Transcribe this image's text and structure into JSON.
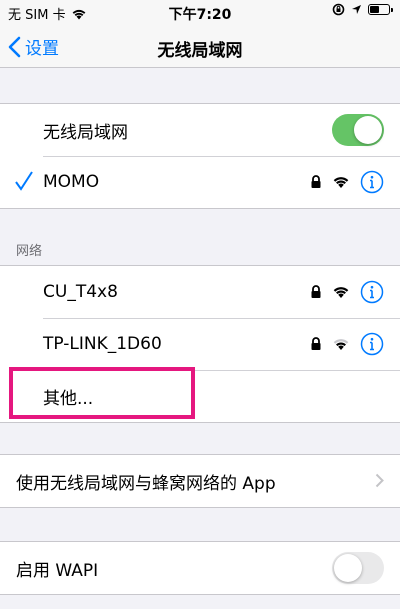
{
  "status_bar": {
    "carrier": "无 SIM 卡",
    "time": "下午7:20",
    "battery_level": 0.55
  },
  "nav": {
    "back_label": "设置",
    "title": "无线局域网"
  },
  "wifi_toggle": {
    "label": "无线局域网",
    "on": true
  },
  "connected_network": {
    "name": "MOMO",
    "secured": true,
    "selected": true
  },
  "networks": {
    "header": "网络",
    "items": [
      {
        "name": "CU_T4x8",
        "secured": true
      },
      {
        "name": "TP-LINK_1D60",
        "secured": true
      }
    ],
    "other_label": "其他..."
  },
  "app_settings": {
    "label": "使用无线局域网与蜂窝网络的 App"
  },
  "wapi": {
    "label": "启用 WAPI",
    "on": false
  },
  "colors": {
    "accent": "#007aff",
    "toggle_on": "#65c466",
    "highlight": "#e5177f"
  }
}
